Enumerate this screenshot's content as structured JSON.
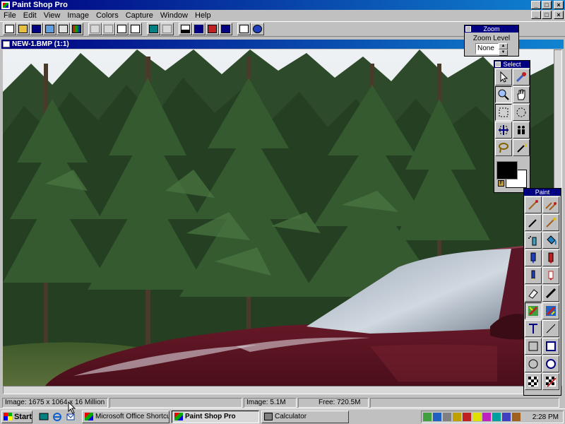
{
  "app": {
    "title": "Paint Shop Pro"
  },
  "menu": [
    "File",
    "Edit",
    "View",
    "Image",
    "Colors",
    "Capture",
    "Window",
    "Help"
  ],
  "toolbar": {
    "icons": [
      "new-icon",
      "open-icon",
      "save-icon",
      "twain-icon",
      "print-icon",
      "color-palette-icon",
      "undo-icon",
      "cut-icon",
      "copy-icon",
      "paste-icon",
      "capture-icon",
      "zoom-icon",
      "histogram-icon",
      "toggle-select-icon",
      "toggle-paint-icon",
      "toggle-zoom-icon",
      "context-help-icon",
      "help-icon"
    ]
  },
  "document": {
    "title": "NEW-1.BMP (1:1)"
  },
  "zoom_palette": {
    "title": "Zoom",
    "label": "Zoom Level",
    "value": "None"
  },
  "select_palette": {
    "title": "Select",
    "tools": [
      "arrow-icon",
      "eyedropper-icon",
      "magnifier-icon",
      "hand-icon",
      "rect-select-icon",
      "ellipse-select-icon",
      "move-icon",
      "clone-icon",
      "lasso-icon",
      "magic-wand-icon"
    ],
    "foreground": "#000000",
    "background": "#ffffff"
  },
  "paint_palette": {
    "title": "Paint",
    "tools": [
      "paintbrush-icon",
      "clone-brush-icon",
      "pen-icon",
      "color-replacer-icon",
      "airbrush-icon",
      "flood-fill-icon",
      "marker-icon",
      "crayon-icon",
      "pencil-icon",
      "chalk-icon",
      "eraser-icon",
      "line-brush-icon",
      "retouch-icon",
      "color-fill-icon",
      "text-icon",
      "line-icon",
      "rectangle-icon",
      "filled-rectangle-icon",
      "ellipse-icon",
      "filled-ellipse-icon",
      "pattern-icon",
      "gradient-icon"
    ]
  },
  "status": {
    "image_info": "Image: 1675 x 1064 x 16 Million",
    "memory": "Image: 5.1M",
    "free": "Free: 720.5M"
  },
  "taskbar": {
    "start": "Start",
    "items": [
      {
        "label": "Microsoft Office Shortcut ...",
        "active": false
      },
      {
        "label": "Paint Shop Pro",
        "active": true
      },
      {
        "label": "Calculator",
        "active": false
      }
    ],
    "clock": "2:28 PM"
  },
  "colors": {
    "titlebar": "#000080",
    "face": "#c0c0c0",
    "car": "#6a1a2a"
  }
}
